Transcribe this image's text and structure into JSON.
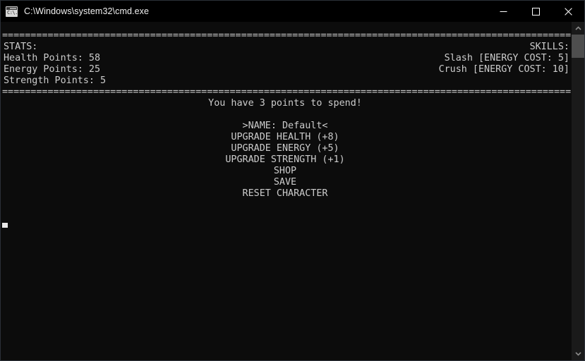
{
  "window": {
    "title": "C:\\Windows\\system32\\cmd.exe",
    "icon": "cmd-console-icon",
    "icon_prompt": "C:\\.",
    "background_color": "#0c0c0c",
    "text_color": "#cccccc",
    "buttons": {
      "minimize": "minimize-icon",
      "maximize": "maximize-icon",
      "close": "close-icon"
    }
  },
  "console": {
    "separator_top": "====================================================================================================",
    "separator_bottom": "====================================================================================================",
    "stats_header": "STATS:",
    "skills_header": "SKILLS:",
    "stats": [
      "Health Points: 58",
      "Energy Points: 25",
      "Strength Points: 5"
    ],
    "skills": [
      "Slash [ENERGY COST: 5]",
      "Crush [ENERGY COST: 10]"
    ],
    "points_message": "You have 3 points to spend!",
    "menu": [
      ">NAME: Default<",
      "UPGRADE HEALTH (+8)",
      "UPGRADE ENERGY (+5)",
      "UPGRADE STRENGTH (+1)",
      "SHOP",
      "SAVE",
      "RESET CHARACTER"
    ],
    "cursor": "_"
  },
  "scrollbar": {
    "up_arrow": "chevron-up-icon",
    "down_arrow": "chevron-down-icon",
    "thumb": "scrollbar-thumb"
  }
}
